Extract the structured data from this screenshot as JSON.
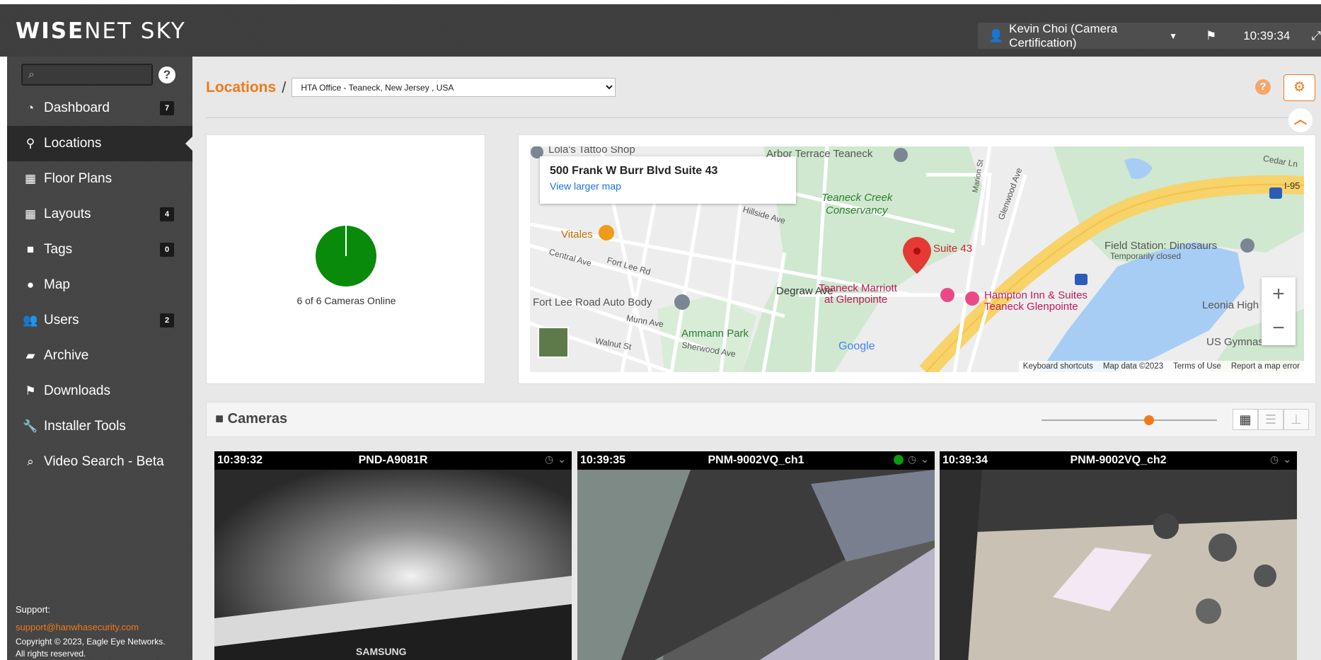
{
  "app": {
    "logo_bold": "WISE",
    "logo_rest": "NET SKY",
    "user_name": "Kevin Choi (Camera Certification)",
    "clock": "10:39:34"
  },
  "sidebar": {
    "items": [
      {
        "label": "Dashboard",
        "badge": "7",
        "icon": "dashboard-icon"
      },
      {
        "label": "Locations",
        "badge": "",
        "icon": "map-pin-icon"
      },
      {
        "label": "Floor Plans",
        "badge": "",
        "icon": "floor-plan-icon"
      },
      {
        "label": "Layouts",
        "badge": "4",
        "icon": "grid-icon"
      },
      {
        "label": "Tags",
        "badge": "0",
        "icon": "video-camera-icon"
      },
      {
        "label": "Map",
        "badge": "",
        "icon": "globe-icon"
      },
      {
        "label": "Users",
        "badge": "2",
        "icon": "users-icon"
      },
      {
        "label": "Archive",
        "badge": "",
        "icon": "folder-open-icon"
      },
      {
        "label": "Downloads",
        "badge": "",
        "icon": "flag-icon"
      },
      {
        "label": "Installer Tools",
        "badge": "",
        "icon": "wrench-icon"
      },
      {
        "label": "Video Search - Beta",
        "badge": "",
        "icon": "search-icon"
      }
    ],
    "support_label": "Support:",
    "support_email": "support@hanwhasecurity.com",
    "copyright_1": "Copyright © 2023, Eagle Eye Networks.",
    "copyright_2": "All rights reserved."
  },
  "page": {
    "breadcrumb_root": "Locations",
    "location_selected": "HTA Office - Teaneck, New Jersey , USA"
  },
  "summary": {
    "cameras_online_text": "6 of 6 Cameras Online",
    "online": 6,
    "total": 6,
    "online_color": "#0a8a0a"
  },
  "map": {
    "address": "500 Frank W Burr Blvd Suite 43",
    "larger_map_link": "View larger map",
    "pin_label": "Suite 43",
    "labels": {
      "lolas": "Lola's Tattoo Shop",
      "arbor": "Arbor Terrace Teaneck",
      "creek": "Teaneck Creek",
      "conservancy": "Conservancy",
      "vitales": "Vitales",
      "hillside": "Hillside Ave",
      "central": "Central Ave",
      "fortleerd": "Fort Lee Rd",
      "fortlee_auto": "Fort Lee Road Auto Body",
      "degraw": "Degraw Ave",
      "marriott_1": "Teaneck Marriott",
      "marriott_2": "at Glenpointe",
      "hampton_1": "Hampton Inn & Suites",
      "hampton_2": "Teaneck Glenpointe",
      "field_station": "Field Station: Dinosaurs",
      "temp_closed": "Temporarily closed",
      "leonia": "Leonia High Schoo",
      "ammann": "Ammann Park",
      "munn": "Munn Ave",
      "walnut": "Walnut St",
      "sherwood": "Sherwood Ave",
      "us_gym": "US Gymnastics",
      "glenwood": "Glenwood Ave",
      "marion": "Marion St",
      "cedar": "Cedar Ln",
      "i95": "I-95",
      "google": "Google"
    },
    "attribution": [
      "Keyboard shortcuts",
      "Map data ©2023",
      "Terms of Use",
      "Report a map error"
    ]
  },
  "cameras": {
    "title": "Cameras",
    "feeds": [
      {
        "time": "10:39:32",
        "name": "PND-A9081R",
        "status": "unknown"
      },
      {
        "time": "10:39:35",
        "name": "PNM-9002VQ_ch1",
        "status": "online"
      },
      {
        "time": "10:39:34",
        "name": "PNM-9002VQ_ch2",
        "status": "unknown"
      }
    ]
  },
  "camera_overlay_text": "SAMSUNG"
}
